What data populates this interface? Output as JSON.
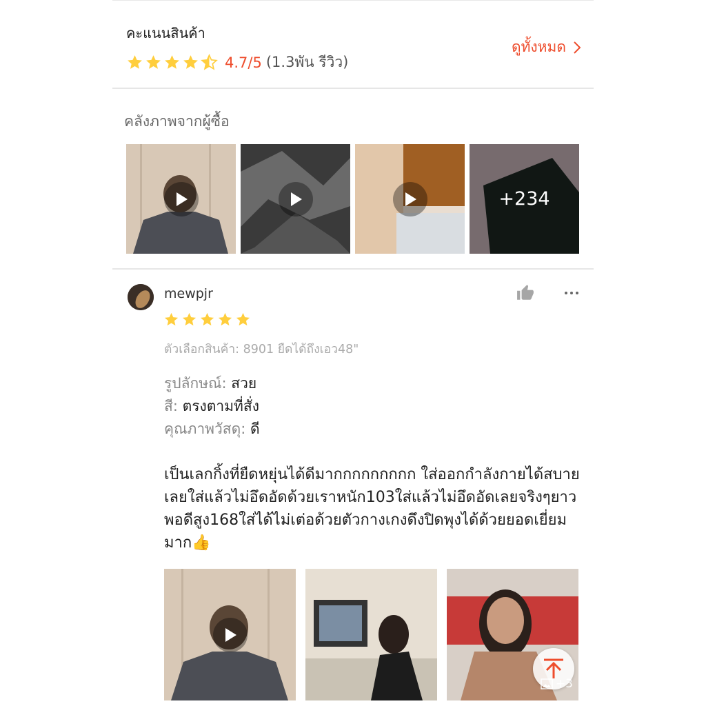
{
  "rating": {
    "title": "คะแนนสินค้า",
    "score": "4.7/5",
    "count": "(1.3พัน รีวิว)",
    "see_all": "ดูทั้งหมด"
  },
  "gallery": {
    "title": "คลังภาพจากผู้ซื้อ",
    "more_count": "+234"
  },
  "review": {
    "username": "mewpjr",
    "variation": "ตัวเลือกสินค้า: 8901 ยืดได้ถึงเอว48\"",
    "attributes": [
      {
        "key": "รูปลักษณ์:",
        "value": "สวย"
      },
      {
        "key": "สี:",
        "value": "ตรงตามที่สั่ง"
      },
      {
        "key": "คุณภาพวัสดุ:",
        "value": "ดี"
      }
    ],
    "text": "เป็นเลกกิ้งที่ยืดหยุ่นได้ดีมากกกกกกกกก ใส่ออกกำลังกายได้สบายเลยใส่แล้วไม่อึดอัดด้วยเราหนัก103ใส่แล้วไม่อึดอัดเลยจริงๆยาวพอดีสูง168ใส่ได้ไม่เต่อด้วยตัวกางเกงดึงปิดพุงได้ด้วยยอดเยี่ยมมาก👍",
    "image_count": "+3"
  },
  "colors": {
    "accent": "#ee4d2d",
    "star": "#ffce3d"
  }
}
